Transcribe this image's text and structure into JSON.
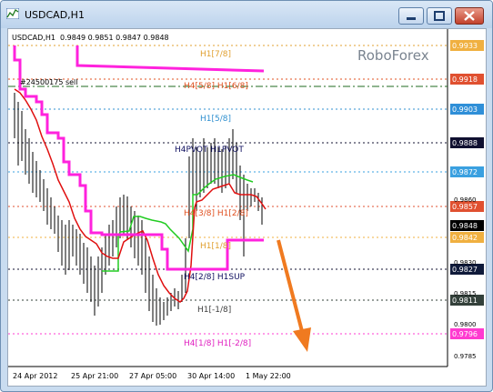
{
  "window": {
    "title": "USDCAD,H1"
  },
  "chart": {
    "symbol_info": "USDCAD,H1  0.9849 0.9851 0.9847 0.9848",
    "brand": "RoboForex",
    "order_label": "#24500175 sell",
    "levels": [
      {
        "label": "H1[7/8]",
        "color": "#e0a030"
      },
      {
        "label": "H4[5/8] H1[6/8]",
        "color": "#e05020"
      },
      {
        "label": "H1[5/8]",
        "color": "#3090d0"
      },
      {
        "label": "H4PVOT H1PVOT",
        "color": "#101060"
      },
      {
        "label": "H4[3/8] H1[2/8]",
        "color": "#e05020"
      },
      {
        "label": "H1[1/8]",
        "color": "#e0a030"
      },
      {
        "label": "H4[2/8] H1SUP",
        "color": "#101060"
      },
      {
        "label": "H1[-1/8]",
        "color": "#404040"
      },
      {
        "label": "H4[1/8] H1[-2/8]",
        "color": "#e020c0"
      }
    ],
    "price_tags": [
      {
        "price": "0.9933",
        "bg": "#f0b040"
      },
      {
        "price": "0.9918",
        "bg": "#e05030"
      },
      {
        "price": "0.9903",
        "bg": "#2f8fd8"
      },
      {
        "price": "0.9888",
        "bg": "#101030"
      },
      {
        "price": "0.9872",
        "bg": "#3aa0e0"
      },
      {
        "price": "0.9857",
        "bg": "#e05030"
      },
      {
        "price": "0.9848",
        "bg": "#000000"
      },
      {
        "price": "0.9842",
        "bg": "#f0b040"
      },
      {
        "price": "0.9827",
        "bg": "#0f1a3a"
      },
      {
        "price": "0.9811",
        "bg": "#33403a"
      },
      {
        "price": "0.9796",
        "bg": "#ff3ad0"
      }
    ],
    "axis_prices": [
      "0.9860",
      "0.9830",
      "0.9815",
      "0.9800",
      "0.9785"
    ],
    "time_labels": [
      "24 Apr 2012",
      "25 Apr 21:00",
      "27 Apr 05:00",
      "30 Apr 14:00",
      "1 May 22:00"
    ]
  }
}
